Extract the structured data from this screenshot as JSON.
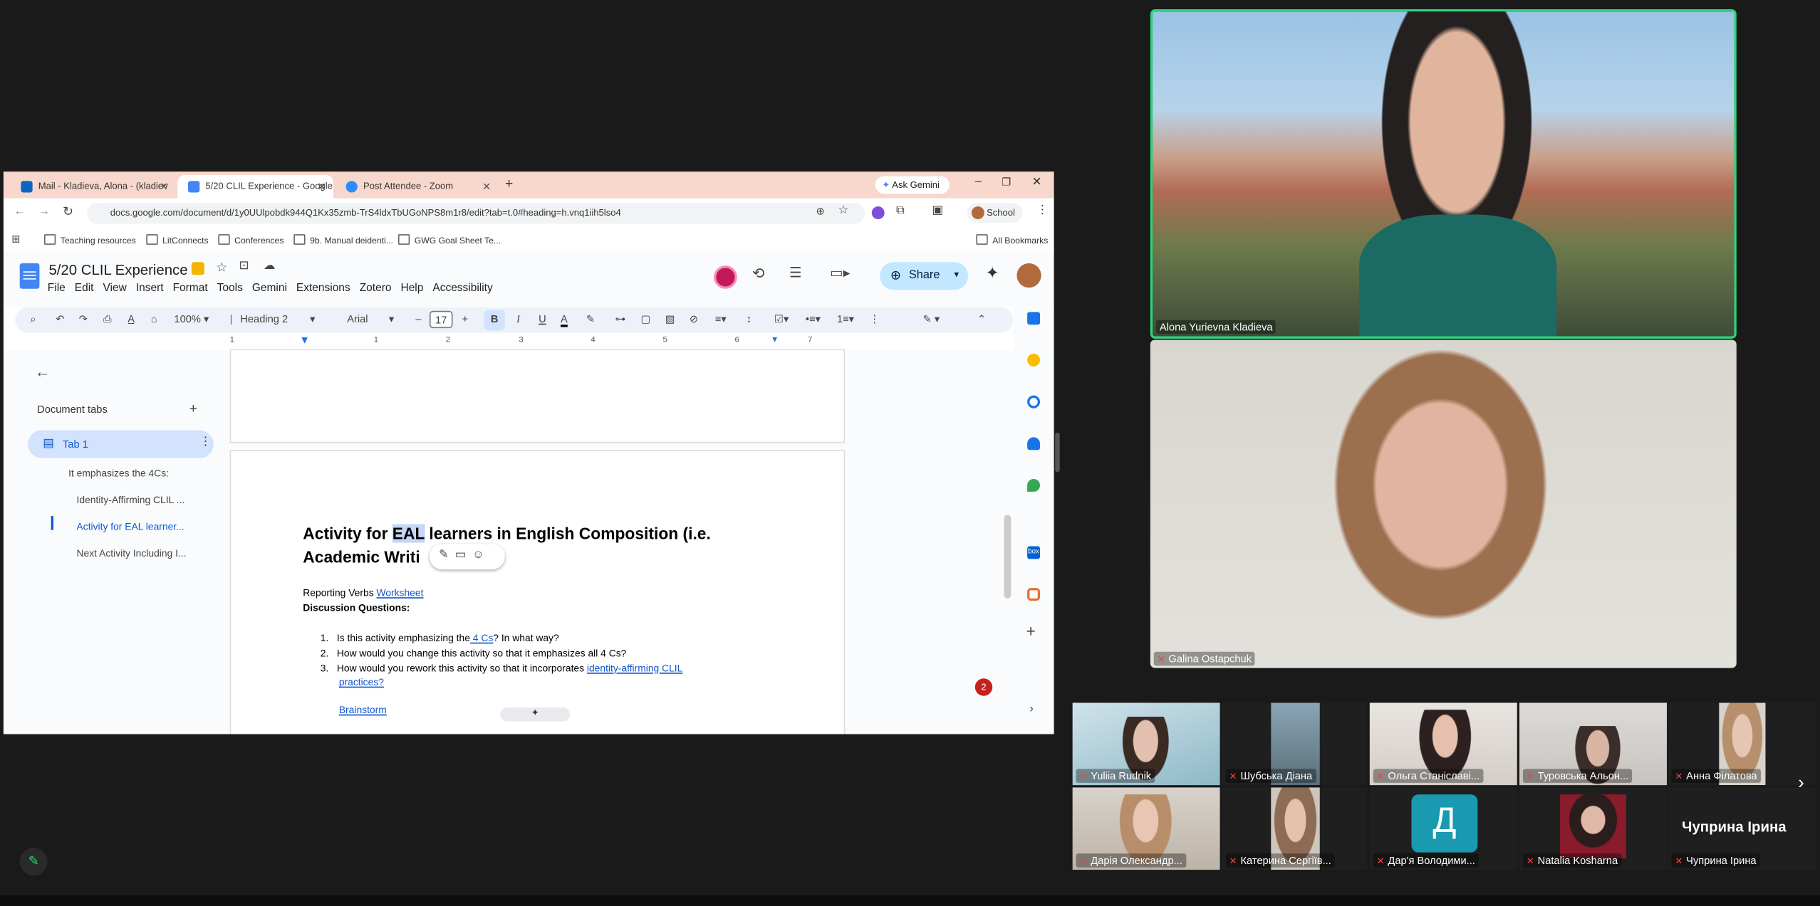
{
  "browser": {
    "tabs": [
      {
        "title": "Mail - Kladieva, Alona - (kladiev",
        "icon_color": "#0a66c2"
      },
      {
        "title": "5/20 CLIL Experience - Google",
        "icon_color": "#4285f4"
      },
      {
        "title": "Post Attendee - Zoom",
        "icon_color": "#2d8cff"
      }
    ],
    "ask_gemini": "Ask Gemini",
    "url": "docs.google.com/document/d/1y0UUlpobdk944Q1Kx35zmb-TrS4ldxTbUGoNPS8m1r8/edit?tab=t.0#heading=h.vnq1iih5lso4",
    "profile_label": "School",
    "bookmarks": [
      "Teaching resources",
      "LitConnects",
      "Conferences",
      "9b. Manual deidenti...",
      "GWG Goal Sheet Te..."
    ],
    "all_bookmarks": "All Bookmarks"
  },
  "docs": {
    "title": "5/20 CLIL Experience",
    "menu": [
      "File",
      "Edit",
      "View",
      "Insert",
      "Format",
      "Tools",
      "Gemini",
      "Extensions",
      "Zotero",
      "Help",
      "Accessibility"
    ],
    "share_label": "Share",
    "toolbar": {
      "zoom": "100%",
      "style": "Heading 2",
      "font": "Arial",
      "font_size": "17"
    },
    "ruler_ticks": [
      "1",
      "1",
      "2",
      "3",
      "4",
      "5",
      "6",
      "7"
    ],
    "outline": {
      "header": "Document tabs",
      "tab": "Tab 1",
      "items": [
        "It emphasizes the 4Cs:",
        "Identity-Affirming CLIL ...",
        "Activity for EAL learner...",
        "Next Activity Including I..."
      ]
    },
    "content": {
      "heading_pre": "Activity for ",
      "heading_sel": "EAL",
      "heading_post": " learners in English Composition (i.e.",
      "heading_line2": "Academic Writi",
      "reporting_verbs": "Reporting Verbs ",
      "worksheet_link": "Worksheet",
      "discussion": "Discussion Questions:",
      "q1_pre": "Is this activity emphasizing the",
      "q1_link": " 4 Cs",
      "q1_post": "? In what way?",
      "q2": "How would you change this activity so that it emphasizes all 4 Cs?",
      "q3_pre": "How would you rework this activity so that it incorporates ",
      "q3_link": "identity-affirming CLIL",
      "q3_link2": "practices?",
      "brainstorm": "Brainstorm",
      "comment_count": "2"
    }
  },
  "zoom": {
    "speaker": "Alona Yurievna Kladieva",
    "second": "Galina Ostapchuk",
    "gallery": [
      "Yuliia Rudnik",
      "Шубська Діана",
      "Ольга Станіславі...",
      "Туровська Альон...",
      "Анна Філатова",
      "Дарія Олександр...",
      "Катерина Сергіїв...",
      "Дар'я Володими...",
      "Natalia Kosharna",
      "Чуприна Ірина"
    ],
    "avatar_letter": "Д",
    "big_name": "Чуприна Ірина"
  }
}
